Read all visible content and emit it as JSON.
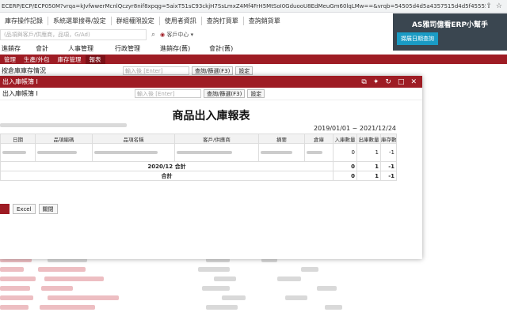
{
  "browser": {
    "url": "ECERP/ECP/ECP050M?vrqa=kJvfwwerMcnlQczyr8nif8xpqg=5aixT51sC93ckjH7SsLmxZ4Mf4FrH5MtSoI0GduooU8EdMeuGm60lqLMw==&vrqb=54505d4d5a4357515d4d5f45555559455f..."
  },
  "toplinks": [
    "庫存操作記錄",
    "系統選單搜尋/設定",
    "群組權限設定",
    "使用者資訊",
    "查詢打買單",
    "查詢銷貨單"
  ],
  "search": {
    "placeholder": "(品項與客戶/供應商，品項，G/Ad)",
    "user_menu": "客戶中心 ▾"
  },
  "mainnav": [
    "會計",
    "人事管理",
    "行政管理",
    "進銷存(舊)",
    "會計(舊)"
  ],
  "mainnav_first": "進銷存",
  "subnav": [
    "管理",
    "生產/外包",
    "庫存管理",
    "報表"
  ],
  "page": {
    "title": "按倉庫庫存情況",
    "input_placeholder": "輸入後 [Enter]",
    "search_button": "查詢/篩選(F3)",
    "settings_button": "設定"
  },
  "helper": {
    "title": "AS雅司億看ERP小幫手",
    "button": "擷展日期查詢"
  },
  "modal": {
    "header_title": "出入庫帳簿 I",
    "sub_title": "出入庫帳簿 I",
    "input_placeholder": "輸入後 [Enter]",
    "search_button": "查詢/篩選(F3)",
    "settings_button": "設定",
    "report_title": "商品出入庫報表",
    "date_range": "2019/01/01 ~ 2021/12/24",
    "columns": [
      "日期",
      "品項編碼",
      "品項名稱",
      "客戶/供應商",
      "摘要",
      "倉庫",
      "入庫數量",
      "出庫數量",
      "庫存數量"
    ],
    "data_row": {
      "in": "0",
      "out": "1",
      "stock": "-1"
    },
    "month_total": {
      "label": "2020/12 合計",
      "in": "0",
      "out": "1",
      "stock": "-1"
    },
    "grand_total": {
      "label": "合計",
      "in": "0",
      "out": "1",
      "stock": "-1"
    },
    "footer_buttons": [
      "Excel",
      "關閉"
    ]
  },
  "colors": {
    "brand": "#9e1c24",
    "helper_bg": "#3a4650",
    "helper_button": "#1a9bc4"
  }
}
